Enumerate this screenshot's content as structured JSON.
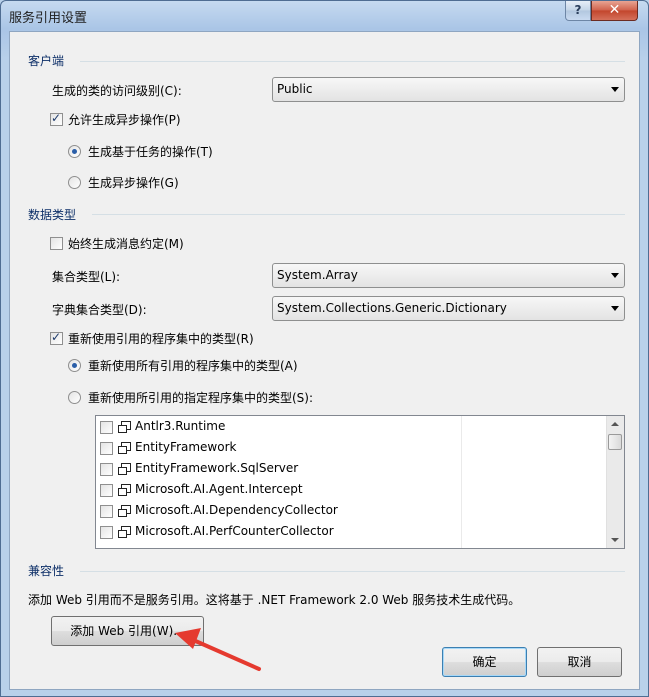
{
  "window": {
    "title": "服务引用设置",
    "help_label": "?",
    "close_label": "✕"
  },
  "client_section": {
    "heading": "客户端",
    "access_level_label": "生成的类的访问级别(C):",
    "access_level_value": "Public",
    "allow_async_label": "允许生成异步操作(P)",
    "allow_async_checked": true,
    "async_options": [
      {
        "label": "生成基于任务的操作(T)",
        "selected": true
      },
      {
        "label": "生成异步操作(G)",
        "selected": false
      }
    ]
  },
  "data_type_section": {
    "heading": "数据类型",
    "always_generate_label": "始终生成消息约定(M)",
    "always_generate_checked": false,
    "collection_type_label": "集合类型(L):",
    "collection_type_value": "System.Array",
    "dictionary_type_label": "字典集合类型(D):",
    "dictionary_type_value": "System.Collections.Generic.Dictionary",
    "reuse_types_label": "重新使用引用的程序集中的类型(R)",
    "reuse_types_checked": true,
    "reuse_options": [
      {
        "label": "重新使用所有引用的程序集中的类型(A)",
        "selected": true
      },
      {
        "label": "重新使用所引用的指定程序集中的类型(S):",
        "selected": false
      }
    ],
    "assemblies": [
      {
        "name": "Antlr3.Runtime",
        "checked": false
      },
      {
        "name": "EntityFramework",
        "checked": false
      },
      {
        "name": "EntityFramework.SqlServer",
        "checked": false
      },
      {
        "name": "Microsoft.AI.Agent.Intercept",
        "checked": false
      },
      {
        "name": "Microsoft.AI.DependencyCollector",
        "checked": false
      },
      {
        "name": "Microsoft.AI.PerfCounterCollector",
        "checked": false
      }
    ]
  },
  "compat_section": {
    "heading": "兼容性",
    "description": "添加 Web 引用而不是服务引用。这将基于 .NET Framework 2.0 Web 服务技术生成代码。",
    "add_web_ref_label": "添加 Web 引用(W)..."
  },
  "footer": {
    "ok_label": "确定",
    "cancel_label": "取消"
  },
  "colors": {
    "section_heading": "#0d2f68",
    "annotation_arrow": "#e53a2f"
  }
}
